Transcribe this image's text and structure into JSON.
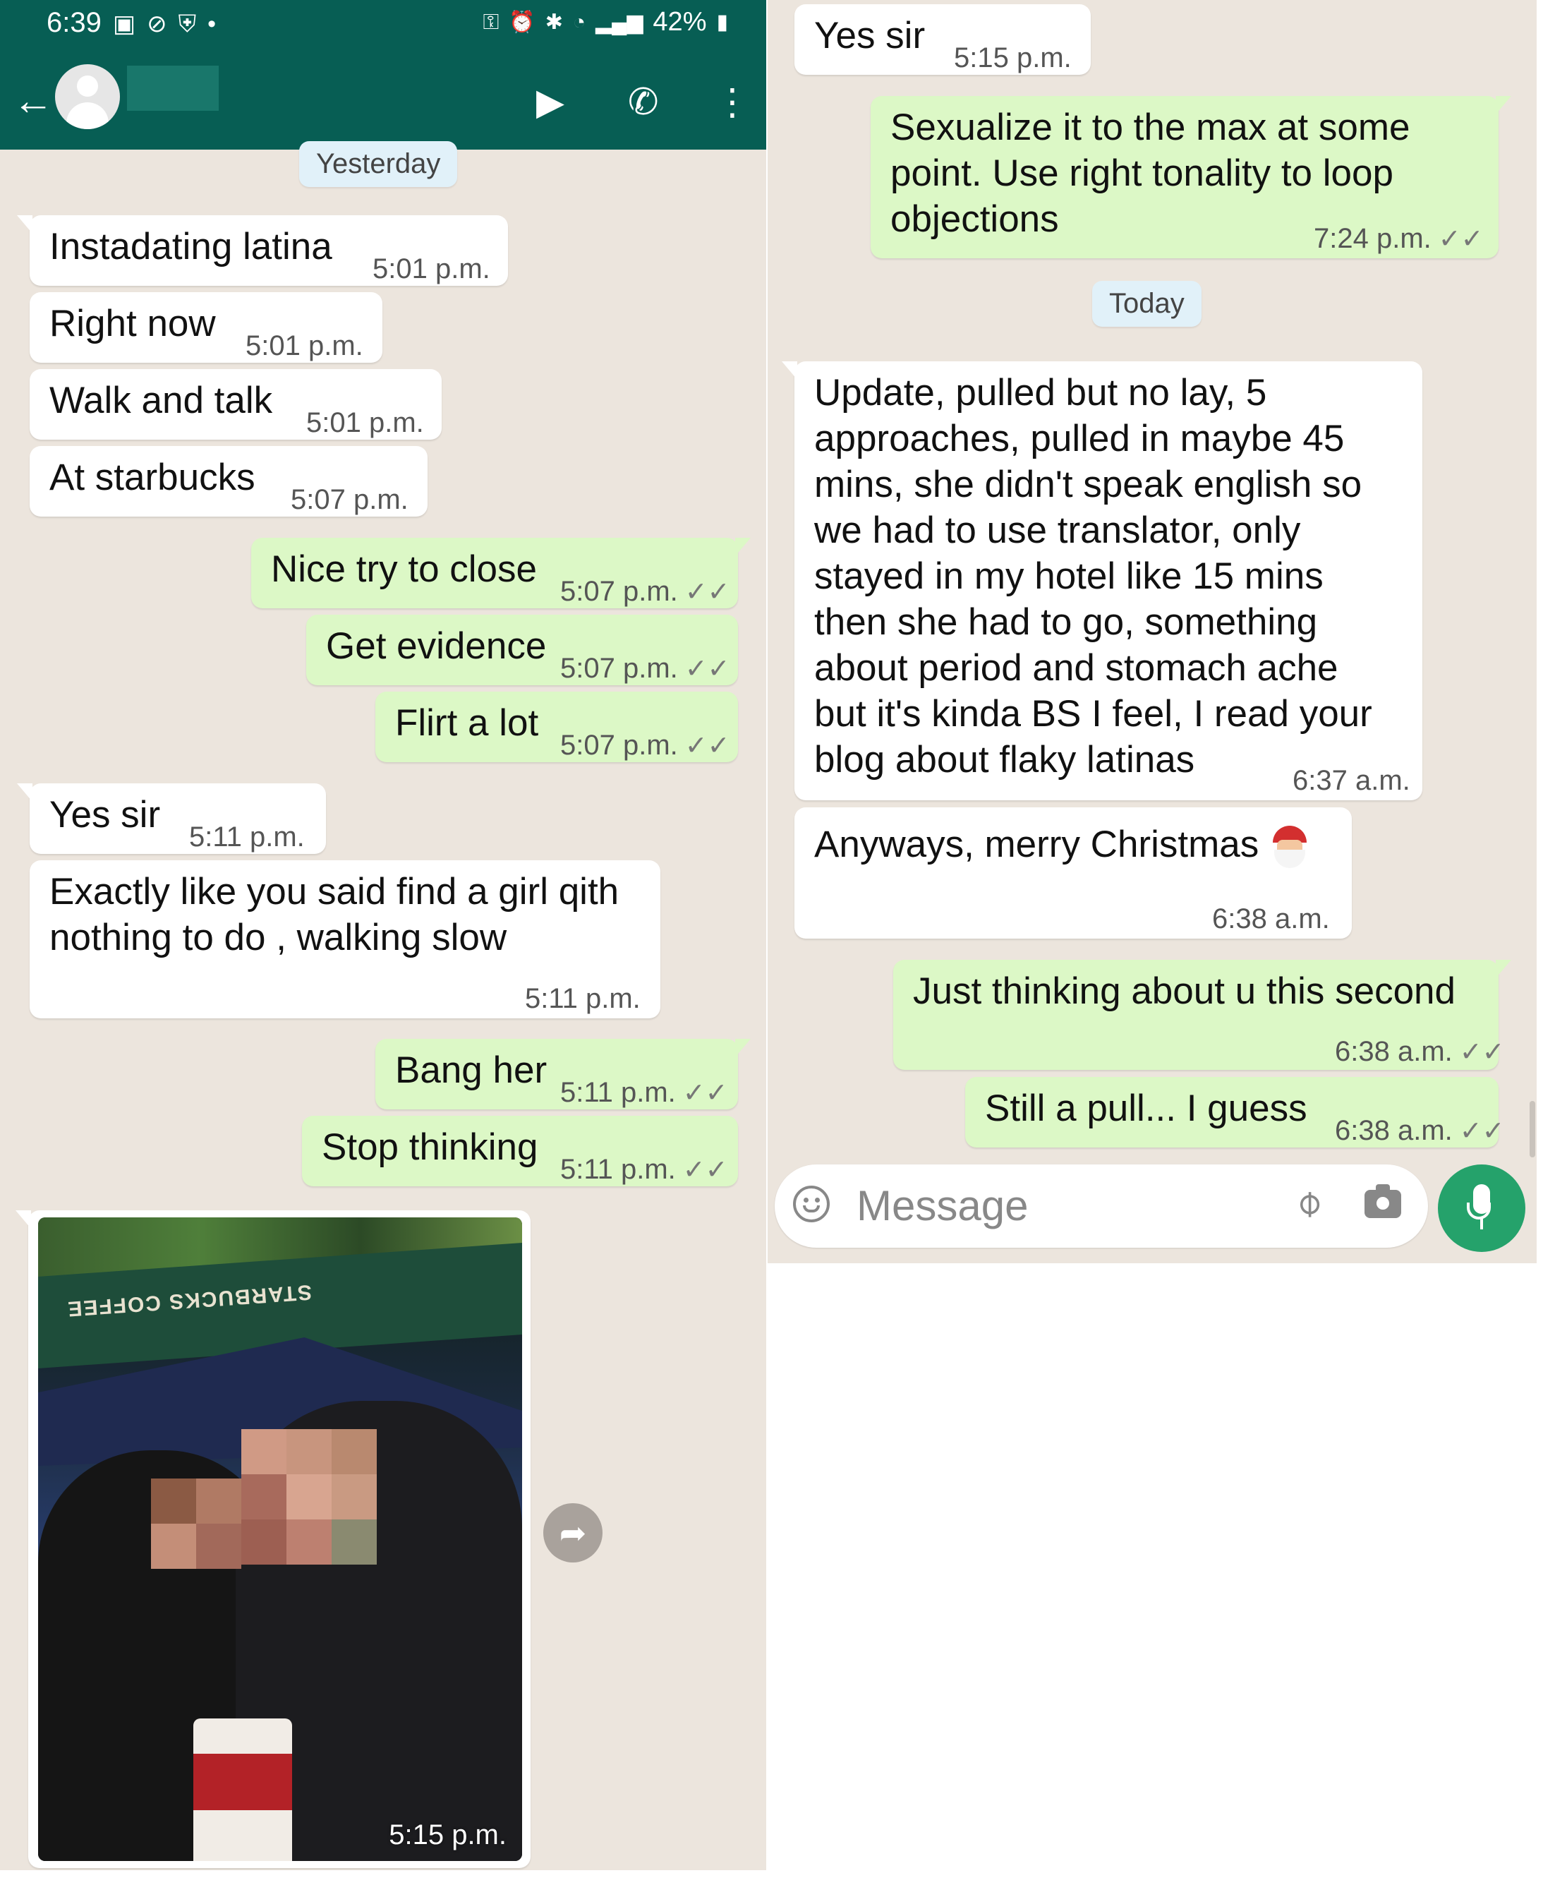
{
  "status_bar": {
    "time": "6:39",
    "left_icons": [
      "image-icon",
      "blocked-icon",
      "shield-icon",
      "dot-icon"
    ],
    "battery": "42%"
  },
  "header": {
    "back_icon": "arrow-left-icon",
    "avatar_icon": "default-avatar-icon",
    "contact_name_redacted": true,
    "actions": [
      "video-call-icon",
      "phone-icon",
      "more-vert-icon"
    ]
  },
  "chat_left": {
    "date_chip": "Yesterday",
    "messages": [
      {
        "dir": "in",
        "text": "Instadating latina",
        "time": "5:01 p.m."
      },
      {
        "dir": "in",
        "text": "Right now",
        "time": "5:01 p.m."
      },
      {
        "dir": "in",
        "text": "Walk and talk",
        "time": "5:01 p.m."
      },
      {
        "dir": "in",
        "text": "At starbucks",
        "time": "5:07 p.m."
      },
      {
        "dir": "out",
        "text": "Nice try to close",
        "time": "5:07 p.m."
      },
      {
        "dir": "out",
        "text": "Get evidence",
        "time": "5:07 p.m."
      },
      {
        "dir": "out",
        "text": "Flirt a lot",
        "time": "5:07 p.m."
      },
      {
        "dir": "in",
        "text": "Yes sir",
        "time": "5:11 p.m."
      },
      {
        "dir": "in",
        "text": "Exactly like you said find a girl qith\nnothing to do , walking slow",
        "time": "5:11 p.m."
      },
      {
        "dir": "out",
        "text": "Bang her",
        "time": "5:11 p.m."
      },
      {
        "dir": "out",
        "text": "Stop thinking",
        "time": "5:11 p.m."
      }
    ],
    "photo": {
      "time": "5:15 p.m.",
      "sign_text": "STARBUCKS COFFEE",
      "forward_icon": "forward-icon"
    }
  },
  "chat_right": {
    "date_chip": "Today",
    "messages": [
      {
        "dir": "in",
        "text": "Yes sir",
        "time": "5:15 p.m."
      },
      {
        "dir": "out",
        "text": "Sexualize it to the max at some\npoint. Use right tonality to loop\nobjections",
        "time": "7:24 p.m."
      },
      {
        "dir": "in",
        "text": "Update, pulled but no lay, 5\napproaches, pulled in maybe 45\nmins, she didn't speak english so\nwe had to use translator, only\nstayed in my hotel like 15 mins\nthen she had to go, something\nabout period and stomach ache\nbut it's kinda BS I feel, I read your\nblog about flaky latinas",
        "time": "6:37 a.m."
      },
      {
        "dir": "in",
        "text": "Anyways, merry Christmas",
        "time": "6:38 a.m.",
        "emoji": "santa-emoji"
      },
      {
        "dir": "out",
        "text": "Just thinking about u this second",
        "time": "6:38 a.m."
      },
      {
        "dir": "out",
        "text": "Still a pull... I guess",
        "time": "6:38 a.m."
      }
    ]
  },
  "composer": {
    "placeholder": "Message",
    "icons": [
      "emoji-icon",
      "attach-icon",
      "camera-icon",
      "mic-icon"
    ]
  },
  "ticks": "✓✓",
  "colors": {
    "header": "#075e54",
    "chat_bg": "#ece5dd",
    "bubble_in": "#ffffff",
    "bubble_out": "#dcf8c6",
    "mic": "#25a26b"
  }
}
